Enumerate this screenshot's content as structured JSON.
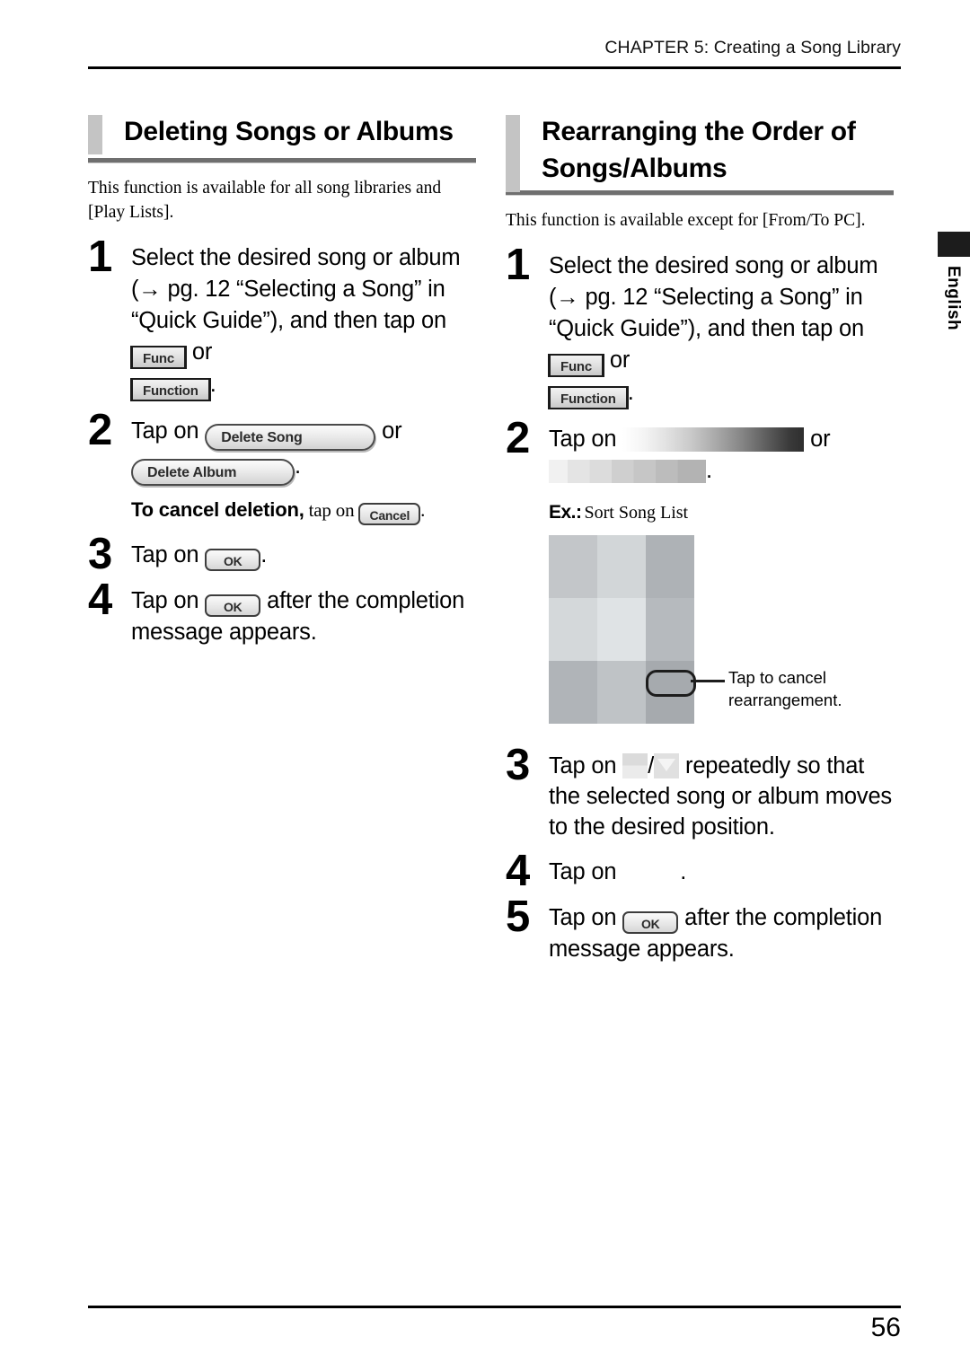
{
  "header": {
    "running_head": "CHAPTER 5: Creating a Song Library"
  },
  "footer": {
    "page_number": "56"
  },
  "side_tab": {
    "label": "English",
    "tab_color": "#1c1c1c"
  },
  "left_column": {
    "heading": "Deleting Songs or Albums",
    "intro": "This function is available for all song libraries and [Play Lists].",
    "steps": [
      {
        "number": "1",
        "text_before": "Select the desired song or album (→ pg. 12 “Selecting a Song” in “Quick Guide”), and then tap on ",
        "button_1": "Func",
        "text_middle": " or ",
        "button_2": "Function",
        "text_after": "."
      },
      {
        "number": "2",
        "text_before": "Tap on ",
        "button_1": "Delete Song",
        "text_middle": " or ",
        "button_2": "Delete Album",
        "text_after": ".",
        "note_bold": "To cancel deletion,",
        "note_text": " tap on ",
        "note_button": "Cancel",
        "note_after": "."
      },
      {
        "number": "3",
        "text_before": "Tap on ",
        "button_1": "OK",
        "text_after": "."
      },
      {
        "number": "4",
        "text_before": "Tap on ",
        "button_1": "OK",
        "text_after": " after the completion message appears."
      }
    ]
  },
  "right_column": {
    "heading_line_1": "Rearranging the Order of",
    "heading_line_2": "Songs/Albums",
    "intro": "This function is available except for [From/To PC].",
    "steps": [
      {
        "number": "1",
        "text_before": "Select the desired song or album (→ pg. 12 “Selecting a Song” in “Quick Guide”), and then tap on ",
        "button_1": "Func",
        "text_middle": " or ",
        "button_2": "Function",
        "text_after": "."
      },
      {
        "number": "2",
        "text_before": "Tap on ",
        "text_middle": " or ",
        "text_after": "."
      },
      {
        "number": "3",
        "text_before": "Tap on ",
        "text_middle": "/",
        "text_after": " repeatedly so that the selected song or album moves to the desired position."
      },
      {
        "number": "4",
        "text_before": "Tap on ",
        "text_after": "."
      },
      {
        "number": "5",
        "text_before": "Tap on ",
        "button_1": "OK",
        "text_after": " after the completion message appears."
      }
    ],
    "example": {
      "label": "Ex.:",
      "caption": "Sort Song List",
      "callout_line_1": "Tap to cancel",
      "callout_line_2": "rearrangement.",
      "screenshot_cells": [
        "#c3c6c9",
        "#d2d6d8",
        "#aeb2b6",
        "#d4d8da",
        "#dfe3e5",
        "#b6babe",
        "#b0b4b8",
        "#bfc3c6",
        "#a6aaae"
      ]
    }
  }
}
